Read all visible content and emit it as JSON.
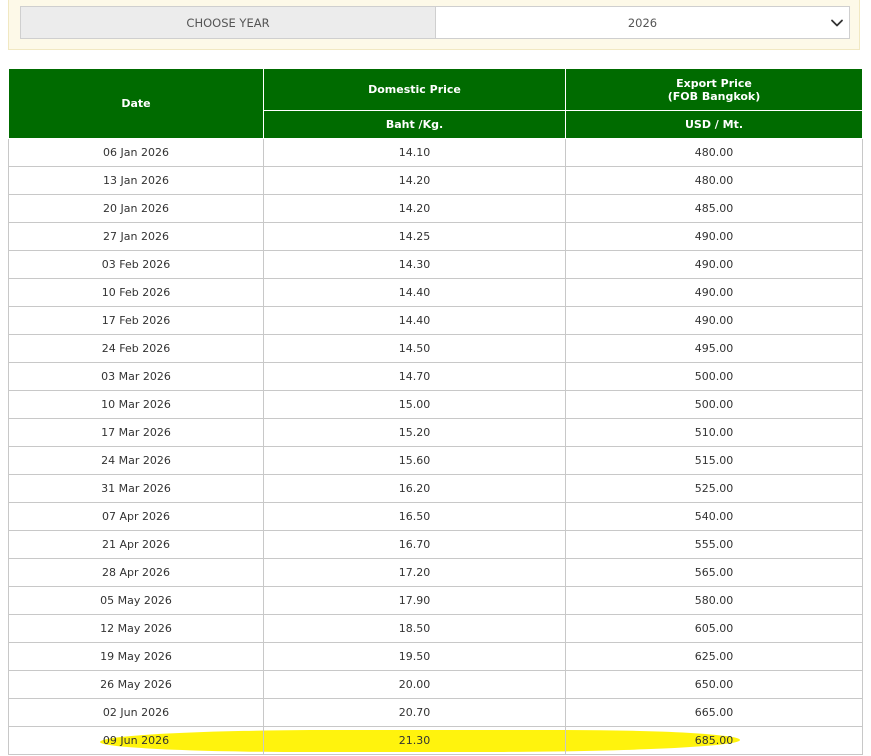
{
  "filter": {
    "label": "CHOOSE YEAR",
    "selected_year": "2026",
    "icon": "chevron-down-icon"
  },
  "table": {
    "header": {
      "date": "Date",
      "domestic": "Domestic Price",
      "export_line1": "Export Price",
      "export_line2": "(FOB Bangkok)",
      "domestic_unit": "Baht /Kg.",
      "export_unit": "USD / Mt."
    },
    "rows": [
      {
        "date": "06 Jan 2026",
        "domestic": "14.10",
        "export": "480.00"
      },
      {
        "date": "13 Jan 2026",
        "domestic": "14.20",
        "export": "480.00"
      },
      {
        "date": "20 Jan 2026",
        "domestic": "14.20",
        "export": "485.00"
      },
      {
        "date": "27 Jan 2026",
        "domestic": "14.25",
        "export": "490.00"
      },
      {
        "date": "03 Feb 2026",
        "domestic": "14.30",
        "export": "490.00"
      },
      {
        "date": "10 Feb 2026",
        "domestic": "14.40",
        "export": "490.00"
      },
      {
        "date": "17 Feb 2026",
        "domestic": "14.40",
        "export": "490.00"
      },
      {
        "date": "24 Feb 2026",
        "domestic": "14.50",
        "export": "495.00"
      },
      {
        "date": "03 Mar 2026",
        "domestic": "14.70",
        "export": "500.00"
      },
      {
        "date": "10 Mar 2026",
        "domestic": "15.00",
        "export": "500.00"
      },
      {
        "date": "17 Mar 2026",
        "domestic": "15.20",
        "export": "510.00"
      },
      {
        "date": "24 Mar 2026",
        "domestic": "15.60",
        "export": "515.00"
      },
      {
        "date": "31 Mar 2026",
        "domestic": "16.20",
        "export": "525.00"
      },
      {
        "date": "07 Apr 2026",
        "domestic": "16.50",
        "export": "540.00"
      },
      {
        "date": "21 Apr 2026",
        "domestic": "16.70",
        "export": "555.00"
      },
      {
        "date": "28 Apr 2026",
        "domestic": "17.20",
        "export": "565.00"
      },
      {
        "date": "05 May 2026",
        "domestic": "17.90",
        "export": "580.00"
      },
      {
        "date": "12 May 2026",
        "domestic": "18.50",
        "export": "605.00"
      },
      {
        "date": "19 May 2026",
        "domestic": "19.50",
        "export": "625.00"
      },
      {
        "date": "26 May 2026",
        "domestic": "20.00",
        "export": "650.00"
      },
      {
        "date": "02 Jun 2026",
        "domestic": "20.70",
        "export": "665.00"
      },
      {
        "date": "09 Jun 2026",
        "domestic": "21.30",
        "export": "685.00",
        "highlighted": true
      }
    ]
  },
  "colors": {
    "header_green": "#006b00",
    "highlight_yellow": "#fff200",
    "panel_background": "#fdf9e8"
  }
}
